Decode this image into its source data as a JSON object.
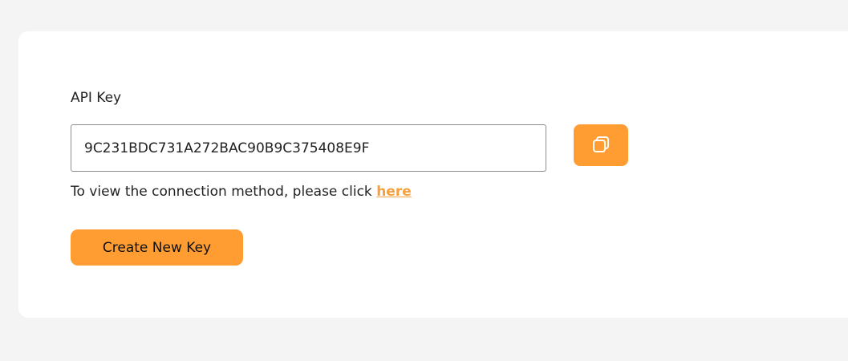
{
  "api_key": {
    "label": "API Key",
    "value": "9C231BDC731A272BAC90B9C375408E9F",
    "copy_icon": "copy-icon"
  },
  "hint": {
    "text": "To view the connection method, please click ",
    "link_label": "here"
  },
  "create_button_label": "Create New Key",
  "colors": {
    "accent": "#ff9d33",
    "link": "#f5a03f",
    "background": "#f4f4f4",
    "card": "#ffffff"
  }
}
